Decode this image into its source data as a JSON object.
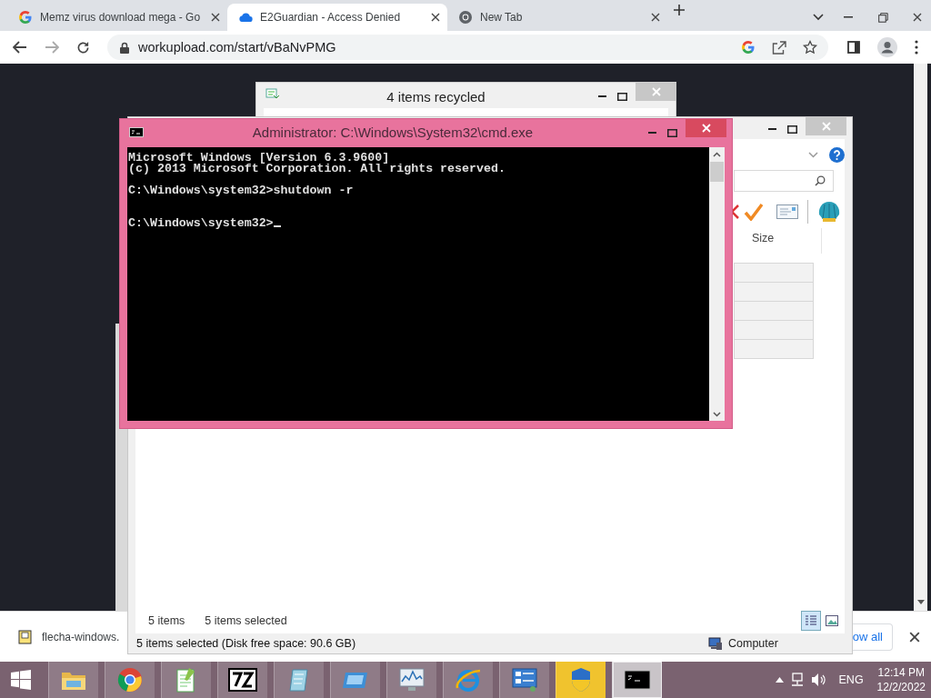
{
  "browser": {
    "tabs": [
      {
        "title": "Memz virus download mega - Go",
        "kind": "google",
        "selected": false
      },
      {
        "title": "E2Guardian - Access Denied",
        "kind": "cloud",
        "selected": true
      },
      {
        "title": "New Tab",
        "kind": "chrome",
        "selected": false
      }
    ],
    "url": "workupload.com/start/vBaNvPMG"
  },
  "download_bar": {
    "file": "flecha-windows.",
    "show_all": "ow all"
  },
  "recycle_window": {
    "title": "4 items recycled"
  },
  "explorer_window": {
    "column": "Size",
    "rows": [
      {
        "selected": true
      },
      {
        "selected": true
      },
      {
        "selected": true
      },
      {
        "selected": true
      },
      {
        "selected": true
      }
    ],
    "item_count": "5 items",
    "selected_count": "5 items selected",
    "views": [
      {
        "kind": "details",
        "selected": true
      },
      {
        "kind": "preview",
        "selected": false
      }
    ],
    "status": "5 items selected (Disk free space: 90.6 GB)",
    "location": "Computer"
  },
  "cmd_window": {
    "title": "Administrator: C:\\Windows\\System32\\cmd.exe",
    "lines": [
      {
        "kind": "output",
        "text": "Microsoft Windows [Version 6.3.9600]"
      },
      {
        "kind": "output",
        "text": "(c) 2013 Microsoft Corporation. All rights reserved."
      },
      {
        "kind": "command",
        "text": "C:\\Windows\\system32>shutdown -r"
      },
      {
        "kind": "prompt",
        "text": "C:\\Windows\\system32>"
      }
    ]
  },
  "taskbar": {
    "apps": [
      {
        "kind": "folder",
        "active": false,
        "flashing": false
      },
      {
        "kind": "chrome",
        "active": false,
        "flashing": false
      },
      {
        "kind": "editor",
        "active": false,
        "flashing": false
      },
      {
        "kind": "archiver",
        "active": false,
        "flashing": false
      },
      {
        "kind": "notepad",
        "active": false,
        "flashing": false
      },
      {
        "kind": "window",
        "active": false,
        "flashing": false
      },
      {
        "kind": "monitor",
        "active": false,
        "flashing": false
      },
      {
        "kind": "browser",
        "active": false,
        "flashing": false
      },
      {
        "kind": "panel",
        "active": false,
        "flashing": false
      },
      {
        "kind": "shield",
        "active": false,
        "flashing": true
      },
      {
        "kind": "console",
        "active": true,
        "flashing": false
      }
    ],
    "language": "ENG",
    "time": "12:14 PM",
    "date": "12/2/2022"
  }
}
